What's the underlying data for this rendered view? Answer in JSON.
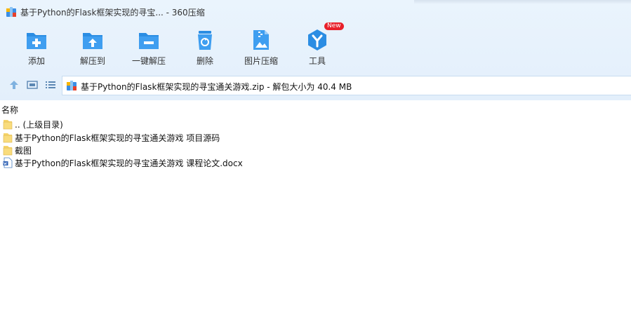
{
  "window": {
    "title": "基于Python的Flask框架实现的寻宝... - 360压缩"
  },
  "toolbar": {
    "items": [
      {
        "label": "添加",
        "icon": "add-folder-icon"
      },
      {
        "label": "解压到",
        "icon": "extract-to-icon"
      },
      {
        "label": "一键解压",
        "icon": "one-click-extract-icon"
      },
      {
        "label": "删除",
        "icon": "delete-trash-icon"
      },
      {
        "label": "图片压缩",
        "icon": "image-compress-icon"
      },
      {
        "label": "工具",
        "icon": "tools-icon",
        "badge": "New"
      }
    ]
  },
  "nav": {
    "path_text": "基于Python的Flask框架实现的寻宝通关游戏.zip - 解包大小为 40.4 MB"
  },
  "columns": {
    "name_header": "名称"
  },
  "files": [
    {
      "name": ".. (上级目录)",
      "icon": "folder-up-icon"
    },
    {
      "name": "基于Python的Flask框架实现的寻宝通关游戏 项目源码",
      "icon": "folder-icon"
    },
    {
      "name": "截图",
      "icon": "folder-icon"
    },
    {
      "name": "基于Python的Flask框架实现的寻宝通关游戏 课程论文.docx",
      "icon": "word-doc-icon"
    }
  ],
  "colors": {
    "accent_blue": "#2b8de3",
    "toolbar_bg": "#e6f1fc",
    "badge_red": "#e8202a"
  }
}
